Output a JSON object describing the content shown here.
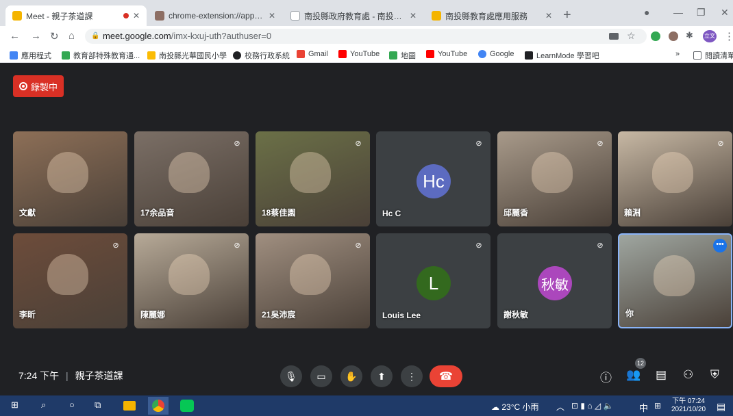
{
  "browser": {
    "tabs": [
      {
        "title": "Meet - 親子茶道課",
        "favicon_color": "#f4b400",
        "active": true,
        "recording": true
      },
      {
        "title": "chrome-extension://appcnhief",
        "favicon_color": "#8d6e63",
        "active": false
      },
      {
        "title": "南投縣政府教育處 - 南投縣政府",
        "favicon_color": "#9aa0a6",
        "active": false
      },
      {
        "title": "南投縣教育處應用服務",
        "favicon_color": "#f4b400",
        "active": false
      }
    ],
    "address_prefix": "meet.google.com",
    "address_path": "/imx-kxuj-uth?authuser=0",
    "profile_label": "立文",
    "bookmarks": [
      {
        "label": "應用程式",
        "color": "#4285f4"
      },
      {
        "label": "教育部特殊教育通...",
        "color": "#34a853"
      },
      {
        "label": "南投縣光華國民小學",
        "color": "#fbbc04"
      },
      {
        "label": "校務行政系統",
        "color": "#202124"
      },
      {
        "label": "Gmail",
        "color": "#ea4335"
      },
      {
        "label": "YouTube",
        "color": "#ff0000"
      },
      {
        "label": "地圖",
        "color": "#34a853"
      },
      {
        "label": "YouTube",
        "color": "#ff0000"
      },
      {
        "label": "Google",
        "color": "#4285f4"
      },
      {
        "label": "LearnMode 學習吧",
        "color": "#202124"
      }
    ],
    "reading_list": "閱讀清單"
  },
  "meet": {
    "recording_label": "錄製中",
    "participants": [
      {
        "name": "文獻",
        "muted": false,
        "video": true,
        "bg": "#8d6f57"
      },
      {
        "name": "17余品音",
        "muted": true,
        "video": true,
        "bg": "#7b6f66"
      },
      {
        "name": "18蔡佳園",
        "muted": true,
        "video": true,
        "bg": "#6b7047"
      },
      {
        "name": "Hc C",
        "muted": true,
        "video": false,
        "initials": "Hc",
        "avatar_color": "#5c6bc0"
      },
      {
        "name": "邱麗香",
        "muted": true,
        "video": true,
        "bg": "#a89a8a"
      },
      {
        "name": "賴淵",
        "muted": true,
        "video": true,
        "bg": "#c7b8a4"
      },
      {
        "name": "李昕",
        "muted": true,
        "video": true,
        "bg": "#6d4c3a"
      },
      {
        "name": "陳麗娜",
        "muted": true,
        "video": true,
        "bg": "#b7aa98"
      },
      {
        "name": "21吳沛宸",
        "muted": true,
        "video": true,
        "bg": "#a08f80"
      },
      {
        "name": "Louis Lee",
        "muted": true,
        "video": false,
        "initials": "L",
        "avatar_color": "#33691e"
      },
      {
        "name": "謝秋敏",
        "muted": true,
        "video": false,
        "initials": "秋敏",
        "avatar_color": "#ab47bc"
      },
      {
        "name": "你",
        "muted": false,
        "video": true,
        "bg": "#9fa6a0",
        "self": true
      }
    ],
    "time": "7:24 下午",
    "meeting_name": "親子茶道課",
    "participant_count": "12"
  },
  "taskbar": {
    "weather": "23°C 小雨",
    "ime": "中",
    "time": "下午 07:24",
    "date": "2021/10/20"
  }
}
